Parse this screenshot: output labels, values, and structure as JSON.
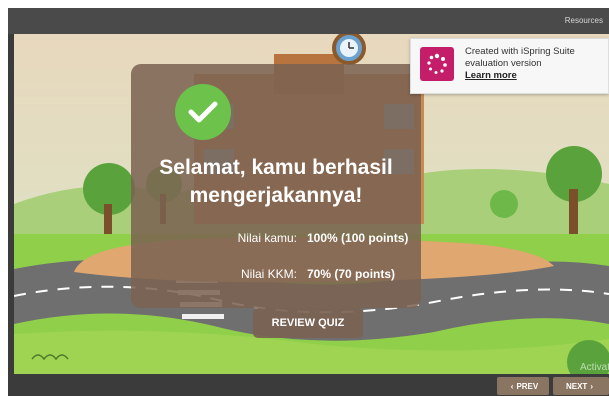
{
  "player": {
    "resources_label": "Resources"
  },
  "result": {
    "icon": "checkmark-icon",
    "title_line1": "Selamat, kamu berhasil",
    "title_line2": "mengerjakannya!",
    "score_label": "Nilai kamu:",
    "score_value": "100% (100 points)",
    "kkm_label": "Nilai KKM:",
    "kkm_value": "70% (70 points)",
    "review_button": "REVIEW QUIZ"
  },
  "banner": {
    "line1": "Created with iSpring Suite",
    "line2": "evaluation version",
    "link": "Learn more",
    "logo_color": "#c41e6a"
  },
  "watermark": "Activate",
  "nav": {
    "prev_label": "PREV",
    "next_label": "NEXT",
    "prev_arrow": "‹",
    "next_arrow": "›"
  },
  "colors": {
    "overlay": "#7a6252",
    "check": "#6cc24a",
    "nav_button": "#8a7563"
  }
}
